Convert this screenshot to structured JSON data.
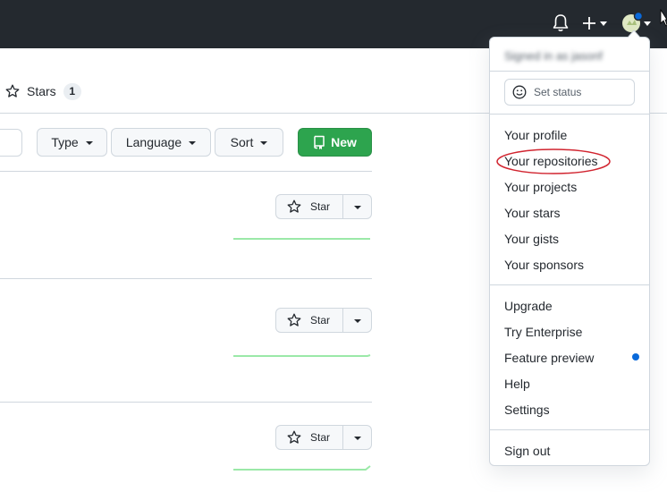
{
  "header": {
    "icons": {
      "notifications": "bell-icon",
      "create": "plus-icon",
      "avatar": "avatar-icon"
    }
  },
  "tabs": {
    "stars": {
      "label": "Stars",
      "count": "1"
    }
  },
  "filters": {
    "type_label": "Type",
    "language_label": "Language",
    "sort_label": "Sort",
    "new_label": "New"
  },
  "repo_rows": [
    {
      "star_label": "Star"
    },
    {
      "star_label": "Star"
    },
    {
      "star_label": "Star"
    }
  ],
  "menu": {
    "signed_in_text": "Signed in as jasonf",
    "set_status_label": "Set status",
    "section1": [
      "Your profile",
      "Your repositories",
      "Your projects",
      "Your stars",
      "Your gists",
      "Your sponsors"
    ],
    "section2": [
      "Upgrade",
      "Try Enterprise",
      "Feature preview",
      "Help",
      "Settings"
    ],
    "sign_out_label": "Sign out"
  },
  "colors": {
    "header_bg": "#24292f",
    "primary_green": "#2da44e",
    "new_indicator": "#0969da",
    "annotation_red": "#d1242f",
    "sparkline": "#9be9a8"
  }
}
